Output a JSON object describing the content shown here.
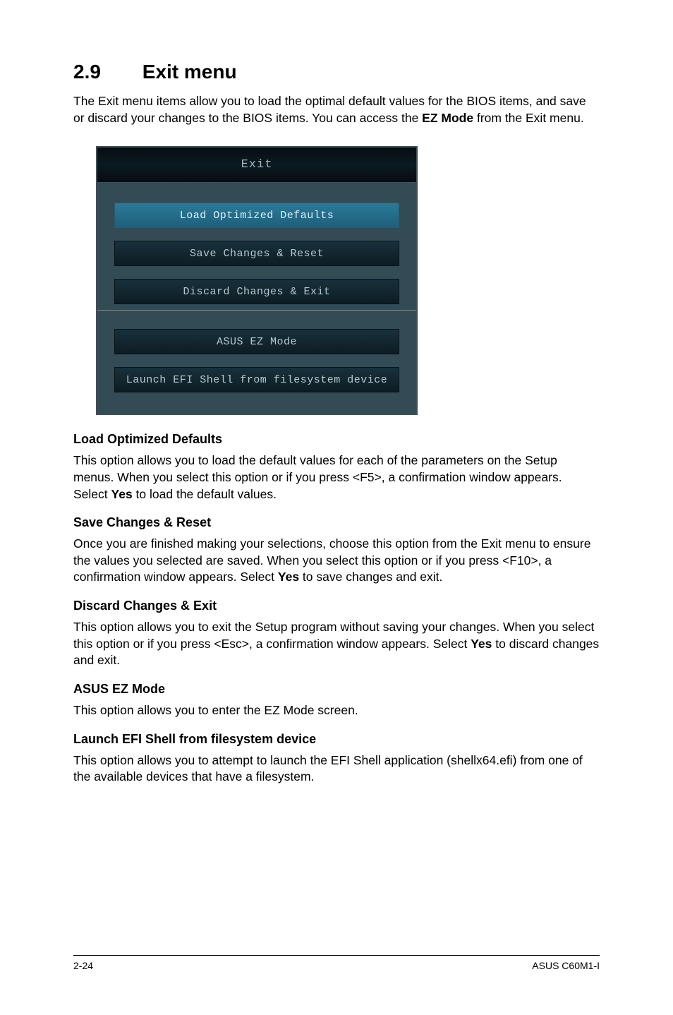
{
  "section": {
    "number": "2.9",
    "title": "Exit menu"
  },
  "intro": {
    "before_bold": "The Exit menu items allow you to load the optimal default values for the BIOS items, and save or discard your changes to the BIOS items. You can access the ",
    "bold": "EZ Mode",
    "after_bold": " from the Exit menu."
  },
  "bios": {
    "header": "Exit",
    "items_top": [
      {
        "label": "Load Optimized Defaults",
        "selected": true
      },
      {
        "label": "Save Changes & Reset",
        "selected": false
      },
      {
        "label": "Discard Changes & Exit",
        "selected": false
      }
    ],
    "items_bottom": [
      {
        "label": "ASUS EZ Mode",
        "selected": false
      },
      {
        "label": "Launch EFI Shell from filesystem device",
        "selected": false
      }
    ]
  },
  "options": [
    {
      "title": "Load Optimized Defaults",
      "body_parts": [
        {
          "t": "This option allows you to load the default values for each of the parameters on the Setup menus. When you select this option or if you press <F5>, a confirmation window appears. Select "
        },
        {
          "t": "Yes",
          "b": true
        },
        {
          "t": " to load the default values."
        }
      ]
    },
    {
      "title": "Save Changes & Reset",
      "body_parts": [
        {
          "t": "Once you are finished making your selections, choose this option from the Exit menu to ensure the values you selected are saved. When you select this option or if you press <F10>, a confirmation window appears. Select "
        },
        {
          "t": "Yes",
          "b": true
        },
        {
          "t": " to save changes and exit."
        }
      ]
    },
    {
      "title": "Discard Changes & Exit",
      "body_parts": [
        {
          "t": "This option allows you to exit the Setup program without saving your changes. When you select this option or if you press <Esc>, a confirmation window appears. Select "
        },
        {
          "t": "Yes",
          "b": true
        },
        {
          "t": " to discard changes and exit."
        }
      ]
    },
    {
      "title": "ASUS EZ Mode",
      "body_parts": [
        {
          "t": "This option allows you to enter the EZ Mode screen."
        }
      ]
    },
    {
      "title": "Launch EFI Shell from filesystem device",
      "body_parts": [
        {
          "t": "This option allows you to attempt to launch the EFI Shell application (shellx64.efi) from one of the available devices that have a filesystem."
        }
      ]
    }
  ],
  "footer": {
    "left": "2-24",
    "right": "ASUS C60M1-I"
  }
}
